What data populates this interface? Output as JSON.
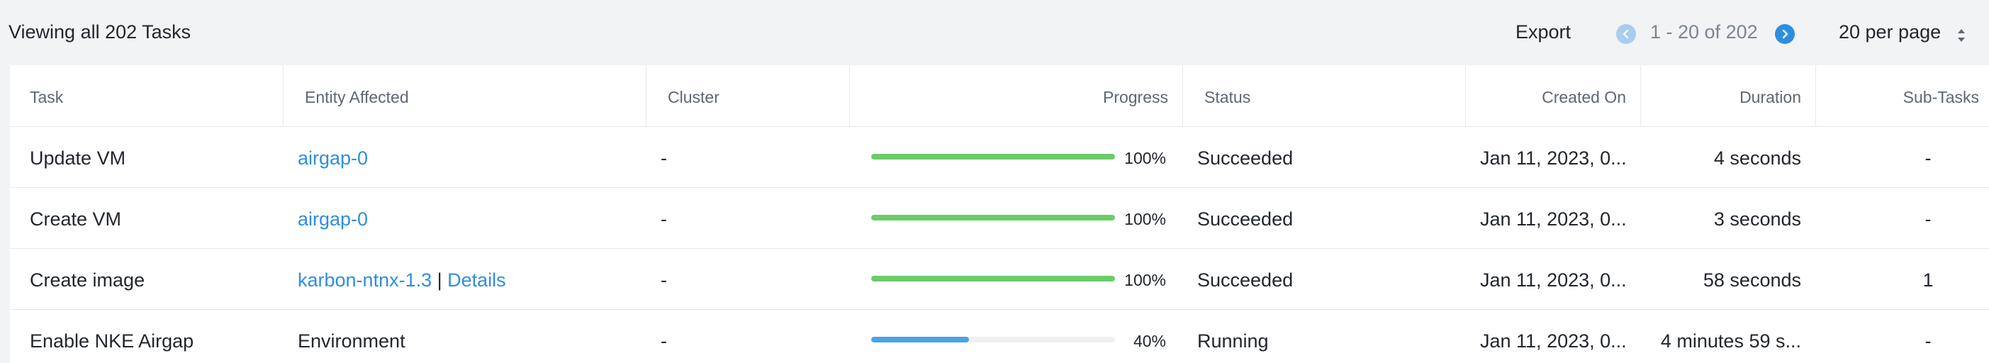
{
  "toolbar": {
    "title": "Viewing all 202 Tasks",
    "export_label": "Export",
    "range_label": "1 - 20 of 202",
    "per_page_label": "20 per page"
  },
  "colors": {
    "success": "#6acc6a",
    "running": "#4aa3e2",
    "link": "#2d8ee0"
  },
  "table": {
    "columns": [
      "Task",
      "Entity Affected",
      "Cluster",
      "Progress",
      "Status",
      "Created On",
      "Duration",
      "Sub-Tasks"
    ],
    "rows": [
      {
        "task": "Update VM",
        "entity": "airgap-0",
        "entity_is_link": true,
        "details": "",
        "cluster": "-",
        "progress": 100,
        "progress_label": "100%",
        "progress_state": "success",
        "status": "Succeeded",
        "created_on": "Jan 11, 2023, 0...",
        "duration": "4 seconds",
        "subtasks": "-"
      },
      {
        "task": "Create VM",
        "entity": "airgap-0",
        "entity_is_link": true,
        "details": "",
        "cluster": "-",
        "progress": 100,
        "progress_label": "100%",
        "progress_state": "success",
        "status": "Succeeded",
        "created_on": "Jan 11, 2023, 0...",
        "duration": "3 seconds",
        "subtasks": "-"
      },
      {
        "task": "Create image",
        "entity": "karbon-ntnx-1.3",
        "entity_is_link": true,
        "details": "Details",
        "cluster": "-",
        "progress": 100,
        "progress_label": "100%",
        "progress_state": "success",
        "status": "Succeeded",
        "created_on": "Jan 11, 2023, 0...",
        "duration": "58 seconds",
        "subtasks": "1"
      },
      {
        "task": "Enable NKE Airgap",
        "entity": "Environment",
        "entity_is_link": false,
        "details": "",
        "cluster": "-",
        "progress": 40,
        "progress_label": "40%",
        "progress_state": "running",
        "status": "Running",
        "created_on": "Jan 11, 2023, 0...",
        "duration": "4 minutes 59 s...",
        "subtasks": "-"
      }
    ]
  }
}
